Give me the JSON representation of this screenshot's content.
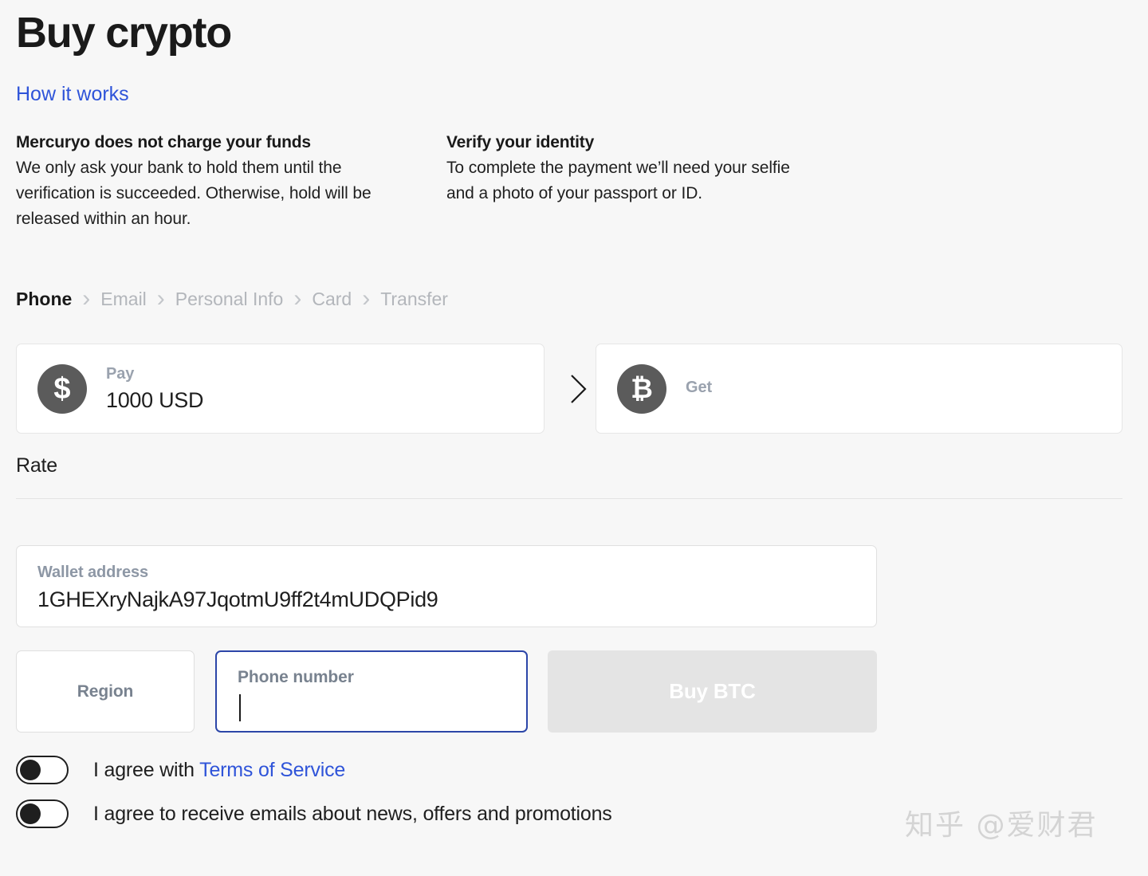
{
  "page": {
    "title": "Buy crypto",
    "how_it_works_link": "How it works",
    "accent_blue": "#2f54d9",
    "background": "#f7f7f7"
  },
  "info": {
    "left": {
      "heading": "Mercuryo does not charge your funds",
      "body": "We only ask your bank to hold them until the verification is succeeded. Otherwise, hold will be released within an hour."
    },
    "right": {
      "heading": "Verify your identity",
      "body": "To complete the payment we’ll need your selfie and a photo of your passport or ID."
    }
  },
  "breadcrumb": {
    "steps": [
      {
        "label": "Phone",
        "active": true
      },
      {
        "label": "Email",
        "active": false
      },
      {
        "label": "Personal Info",
        "active": false
      },
      {
        "label": "Card",
        "active": false
      },
      {
        "label": "Transfer",
        "active": false
      }
    ],
    "separator": "chevron-right-icon"
  },
  "exchange": {
    "pay": {
      "label": "Pay",
      "value": "1000 USD",
      "icon": "dollar-coin-icon",
      "icon_glyph": "$"
    },
    "get": {
      "label": "Get",
      "value": "",
      "icon": "bitcoin-coin-icon",
      "icon_glyph": "₿"
    },
    "separator_icon": "chevron-right-icon"
  },
  "rate": {
    "label": "Rate",
    "value": ""
  },
  "wallet": {
    "label": "Wallet address",
    "value": "1GHEXryNajkA97JqotmU9ff2t4mUDQPid9"
  },
  "form": {
    "region": {
      "label": "Region",
      "value": ""
    },
    "phone": {
      "label": "Phone number",
      "value": "",
      "focused": true,
      "focus_border_color": "#2c46a8"
    },
    "buy_button": {
      "label": "Buy BTC",
      "disabled": true,
      "background": "#e4e4e4"
    }
  },
  "agreements": [
    {
      "checked": false,
      "text_before": "I agree with ",
      "link_text": "Terms of Service",
      "text_after": ""
    },
    {
      "checked": false,
      "text_before": "I agree to receive emails about news, offers and promotions",
      "link_text": "",
      "text_after": ""
    }
  ],
  "watermark": {
    "text": "知乎 @爱财君"
  }
}
